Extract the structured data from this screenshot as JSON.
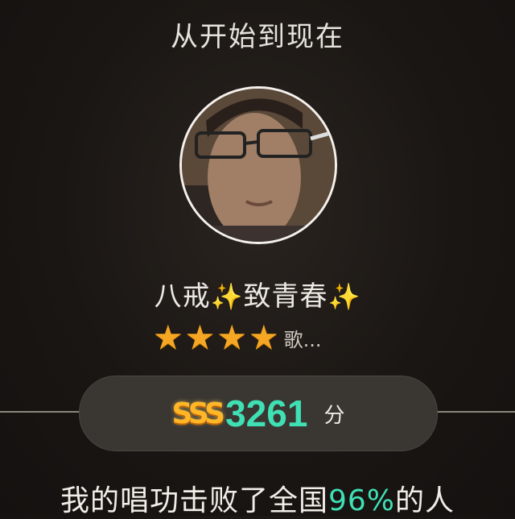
{
  "header": {
    "title": "从开始到现在"
  },
  "profile": {
    "name_part1": "八戒",
    "name_part2": "致青春",
    "sparkle": "✨",
    "rating_stars": 4,
    "star_glyph": "★",
    "rating_suffix": "歌..."
  },
  "score": {
    "badge": "SSS",
    "value": "3261",
    "unit": "分"
  },
  "result": {
    "prefix": "我的唱功击败了全国",
    "percent": "96%",
    "suffix": "的人"
  },
  "colors": {
    "accent": "#3fe0b4",
    "star": "#f5a623",
    "badge": "#ffb627"
  }
}
